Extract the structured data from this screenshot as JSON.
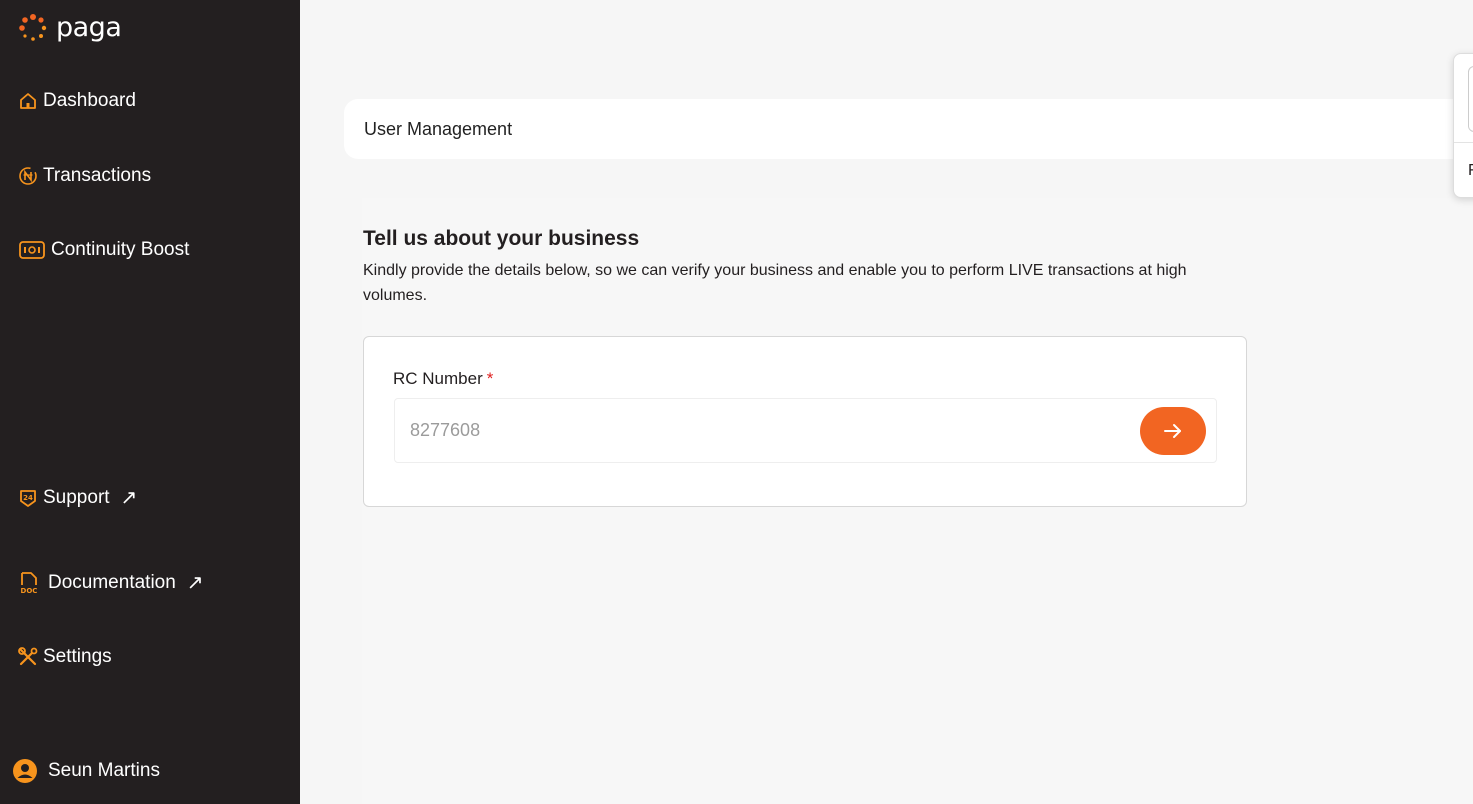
{
  "brand": {
    "name": "paga",
    "accent": "#f26522",
    "sidebar_bg": "#231f20"
  },
  "sidebar": {
    "items": [
      {
        "label": "Dashboard",
        "icon": "home-icon"
      },
      {
        "label": "Transactions",
        "icon": "naira-icon"
      },
      {
        "label": "Continuity Boost",
        "icon": "cash-icon"
      },
      {
        "label": "Support",
        "icon": "support-24-icon",
        "external": true
      },
      {
        "label": "Documentation",
        "icon": "doc-icon",
        "external": true
      },
      {
        "label": "Settings",
        "icon": "tools-icon"
      }
    ],
    "external_glyph": "↗",
    "user": {
      "name": "Seun Martins",
      "icon": "user-avatar-icon"
    }
  },
  "header": {
    "title": "User Management"
  },
  "main": {
    "heading": "Tell us about your business",
    "description": "Kindly provide the details below, so we can verify your business and enable you to perform LIVE transactions at high volumes.",
    "form": {
      "rc_label": "RC Number",
      "required_mark": "*",
      "rc_value": "8277608",
      "submit_icon": "arrow-right-icon"
    }
  },
  "popover": {
    "letter": "F"
  }
}
